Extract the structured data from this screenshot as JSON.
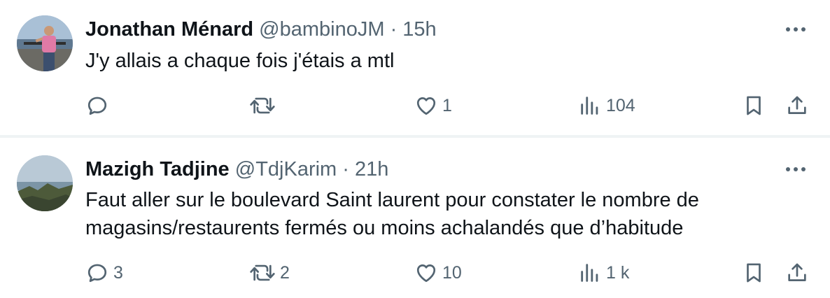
{
  "tweets": [
    {
      "author_name": "Jonathan Ménard",
      "handle": "@bambinoJM",
      "separator": "·",
      "time": "15h",
      "text": "J'y allais a chaque fois j'étais a mtl",
      "replies": "",
      "retweets": "",
      "likes": "1",
      "views": "104"
    },
    {
      "author_name": "Mazigh Tadjine",
      "handle": "@TdjKarim",
      "separator": "·",
      "time": "21h",
      "text": "Faut aller sur le boulevard Saint laurent pour constater le nombre de magasins/restaurents fermés ou moins achalandés que d’habitude",
      "replies": "3",
      "retweets": "2",
      "likes": "10",
      "views": "1 k"
    }
  ],
  "icons": {
    "reply": "reply-icon",
    "retweet": "retweet-icon",
    "like": "heart-icon",
    "views": "views-icon",
    "bookmark": "bookmark-icon",
    "share": "share-icon",
    "more": "more-icon"
  },
  "colors": {
    "text_primary": "#0f1419",
    "text_secondary": "#536471",
    "divider": "#eff3f4"
  }
}
